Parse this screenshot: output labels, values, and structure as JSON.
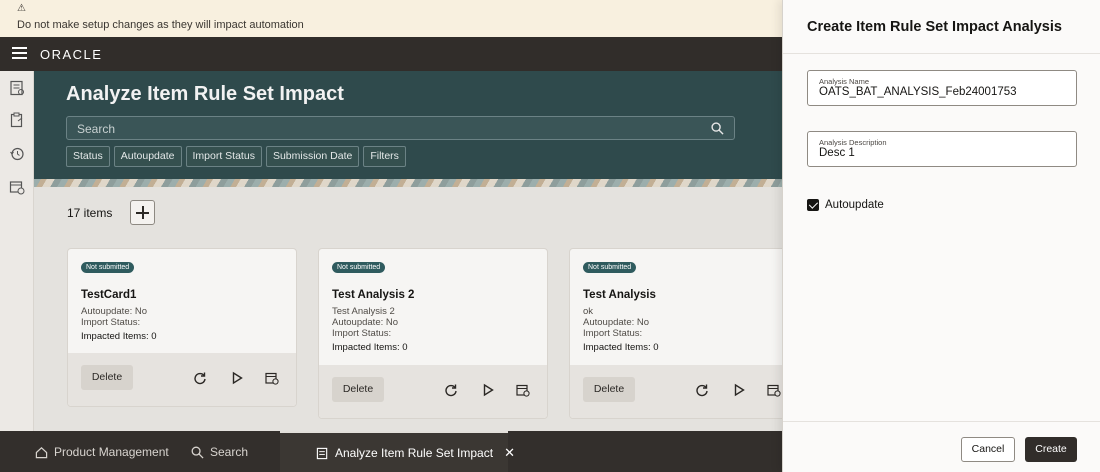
{
  "banner": {
    "icon": "warning-icon",
    "text": "Do not make setup changes as they will impact automation"
  },
  "header": {
    "logo": "ORACLE"
  },
  "page": {
    "title": "Analyze Item Rule Set Impact",
    "search_placeholder": "Search",
    "filters": [
      "Status",
      "Autoupdate",
      "Import Status",
      "Submission Date",
      "Filters"
    ]
  },
  "list": {
    "count_label": "17 items",
    "cards": [
      {
        "status": "Not submitted",
        "title": "TestCard1",
        "lines": [
          "Autoupdate: No",
          "Import Status:"
        ],
        "impacted": "Impacted Items: 0",
        "delete": "Delete"
      },
      {
        "status": "Not submitted",
        "title": "Test Analysis 2",
        "lines": [
          "Test Analysis 2",
          "Autoupdate: No",
          "Import Status:"
        ],
        "impacted": "Impacted Items: 0",
        "delete": "Delete"
      },
      {
        "status": "Not submitted",
        "title": "Test Analysis",
        "lines": [
          "ok",
          "Autoupdate: No",
          "Import Status:"
        ],
        "impacted": "Impacted Items: 0",
        "delete": "Delete"
      }
    ]
  },
  "taskbar": {
    "items": [
      {
        "label": "Product Management",
        "icon": "home-icon"
      },
      {
        "label": "Search",
        "icon": "search-icon"
      },
      {
        "label": "Analyze Item Rule Set Impact",
        "icon": "report-icon"
      }
    ]
  },
  "drawer": {
    "title": "Create Item Rule Set Impact Analysis",
    "name_label": "Analysis Name",
    "name_value": "OATS_BAT_ANALYSIS_Feb24001753",
    "desc_label": "Analysis Description",
    "desc_value": "Desc 1",
    "autoupdate_label": "Autoupdate",
    "autoupdate_checked": true,
    "cancel_label": "Cancel",
    "create_label": "Create"
  }
}
